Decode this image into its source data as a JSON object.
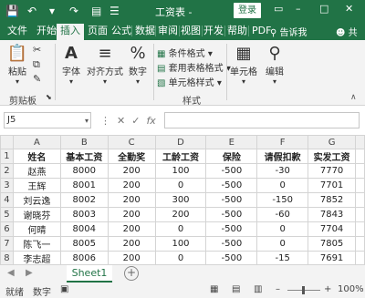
{
  "titlebar": {
    "save_icon": "save-icon",
    "undo_icon": "undo-icon",
    "redo_icon": "redo-icon",
    "document_title": "工资表 -",
    "login_label": "登录",
    "minimize": "–",
    "maximize": "□",
    "close": "✕"
  },
  "ribbon_tabs": [
    "文件",
    "开始",
    "插入",
    "页面",
    "公式",
    "数据",
    "审阅",
    "视图",
    "开发",
    "帮助",
    "PDF"
  ],
  "active_tab": "插入",
  "tell_me": "告诉我",
  "share_label": "共",
  "ribbon": {
    "paste": "粘贴",
    "clipboard_group": "剪贴板",
    "font": "字体",
    "alignment": "对齐方式",
    "number": "数字",
    "conditional_format": "条件格式",
    "table_format": "套用表格格式",
    "cell_styles": "单元格样式",
    "styles_group": "样式",
    "cells": "单元格",
    "editing": "编辑"
  },
  "formula_bar": {
    "name_box": "J5",
    "fx_label": "fx"
  },
  "sheet": {
    "columns": [
      "A",
      "B",
      "C",
      "D",
      "E",
      "F",
      "G"
    ],
    "row_numbers": [
      "1",
      "2",
      "3",
      "4",
      "5",
      "6",
      "7",
      "8"
    ],
    "header": [
      "姓名",
      "基本工资",
      "全勤奖",
      "工龄工资",
      "保险",
      "请假扣款",
      "实发工资"
    ],
    "rows": [
      [
        "赵燕",
        "8000",
        "200",
        "100",
        "-500",
        "-30",
        "7770"
      ],
      [
        "王辉",
        "8001",
        "200",
        "0",
        "-500",
        "0",
        "7701"
      ],
      [
        "刘云逸",
        "8002",
        "200",
        "300",
        "-500",
        "-150",
        "7852"
      ],
      [
        "谢晓芬",
        "8003",
        "200",
        "200",
        "-500",
        "-60",
        "7843"
      ],
      [
        "何晴",
        "8004",
        "200",
        "0",
        "-500",
        "0",
        "7704"
      ],
      [
        "陈飞一",
        "8005",
        "200",
        "100",
        "-500",
        "0",
        "7805"
      ],
      [
        "李志超",
        "8006",
        "200",
        "0",
        "-500",
        "-15",
        "7691"
      ]
    ]
  },
  "sheet_tab": "Sheet1",
  "status": {
    "ready": "就绪",
    "mode": "数字",
    "zoom": "100%"
  },
  "colors": {
    "accent": "#217346",
    "ribbon_bg": "#f3f3f3",
    "header_bg": "#efefef"
  }
}
